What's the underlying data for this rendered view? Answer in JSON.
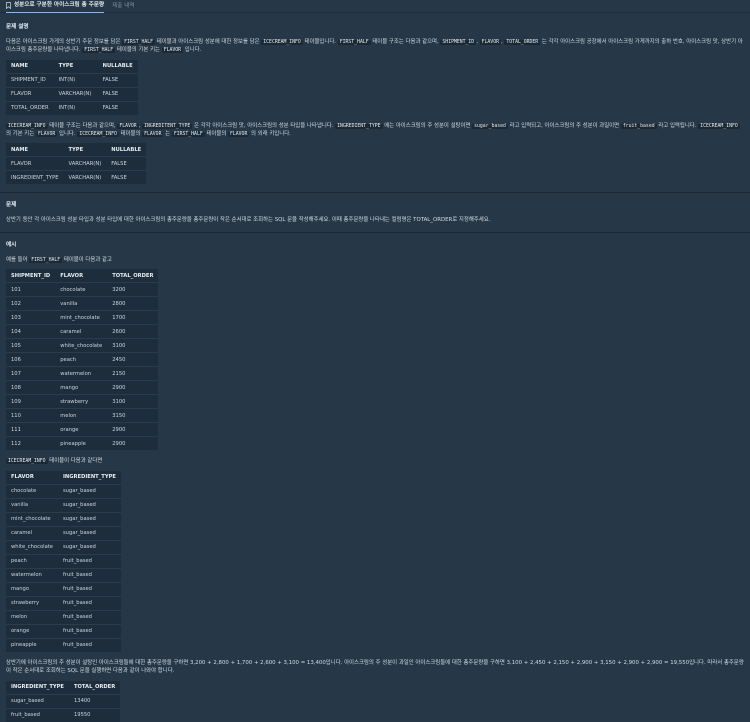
{
  "tabs": {
    "active": "성분으로 구분한 아이스크림 총 주문량",
    "inactive": "제출 내역"
  },
  "section1": {
    "title": "문제 설명",
    "p1": [
      {
        "t": "다음은 아이스크림 가게의 상반기 주문 정보를 담은 "
      },
      {
        "c": "FIRST_HALF"
      },
      {
        "t": " 테이블과 아이스크림 성분에 대한 정보를 담은 "
      },
      {
        "c": "ICECREAM_INFO"
      },
      {
        "t": " 테이블입니다. "
      },
      {
        "c": "FIRST_HALF"
      },
      {
        "t": " 테이블 구조는 다음과 같으며, "
      },
      {
        "c": "SHIPMENT_ID"
      },
      {
        "t": ", "
      },
      {
        "c": "FLAVOR"
      },
      {
        "t": ", "
      },
      {
        "c": "TOTAL_ORDER"
      },
      {
        "t": " 는 각각 아이스크림 공장에서 아이스크림 가게까지의 출하 번호, 아이스크림 맛, 상반기 아이스크림 총주문량을 나타냅니다. "
      },
      {
        "c": "FIRST_HALF"
      },
      {
        "t": " 테이블의 기본 키는 "
      },
      {
        "c": "FLAVOR"
      },
      {
        "t": " 입니다."
      }
    ],
    "table1": {
      "headers": [
        "NAME",
        "TYPE",
        "NULLABLE"
      ],
      "rows": [
        [
          "SHIPMENT_ID",
          "INT(N)",
          "FALSE"
        ],
        [
          "FLAVOR",
          "VARCHAR(N)",
          "FALSE"
        ],
        [
          "TOTAL_ORDER",
          "INT(N)",
          "FALSE"
        ]
      ]
    },
    "p2": [
      {
        "c": "ICECREAM_INFO"
      },
      {
        "t": " 테이블 구조는 다음과 같으며, "
      },
      {
        "c": "FLAVOR"
      },
      {
        "t": ", "
      },
      {
        "c": "INGREDITENT_TYPE"
      },
      {
        "t": " 은 각각 아이스크림 맛, 아이스크림의 성분 타입을 나타냅니다. "
      },
      {
        "c": "INGREDIENT_TYPE"
      },
      {
        "t": " 에는 아이스크림의 주 성분이 설탕이면 "
      },
      {
        "c": "sugar_based"
      },
      {
        "t": " 라고 입력되고, 아이스크림의 주 성분이 과일이면 "
      },
      {
        "c": "fruit_based"
      },
      {
        "t": " 라고 입력됩니다. "
      },
      {
        "c": "ICECREAM_INFO"
      },
      {
        "t": " 의 기본 키는 "
      },
      {
        "c": "FLAVOR"
      },
      {
        "t": " 입니다. "
      },
      {
        "c": "ICECREAM_INFO"
      },
      {
        "t": " 테이블의 "
      },
      {
        "c": "FLAVOR"
      },
      {
        "t": " 는 "
      },
      {
        "c": "FIRST_HALF"
      },
      {
        "t": " 테이블의 "
      },
      {
        "c": "FLAVOR"
      },
      {
        "t": " 의 외래 키입니다."
      }
    ],
    "table2": {
      "headers": [
        "NAME",
        "TYPE",
        "NULLABLE"
      ],
      "rows": [
        [
          "FLAVOR",
          "VARCHAR(N)",
          "FALSE"
        ],
        [
          "INGREDIENT_TYPE",
          "VARCHAR(N)",
          "FALSE"
        ]
      ]
    }
  },
  "section2": {
    "title": "문제",
    "text": "상반기 동안 각 아이스크림 성분 타입과 성분 타입에 대한 아이스크림의 총주문량을 총주문량이 작은 순서대로 조회하는 SQL 문을 작성해주세요. 이때 총주문량을 나타내는 컬럼명은 TOTAL_ORDER로 지정해주세요."
  },
  "section3": {
    "title": "예시",
    "intro": [
      {
        "t": "예를 들어 "
      },
      {
        "c": "FIRST_HALF"
      },
      {
        "t": " 테이블이 다음과 같고"
      }
    ],
    "table3": {
      "headers": [
        "SHIPMENT_ID",
        "FLAVOR",
        "TOTAL_ORDER"
      ],
      "rows": [
        [
          "101",
          "chocolate",
          "3200"
        ],
        [
          "102",
          "vanilla",
          "2800"
        ],
        [
          "103",
          "mint_chocolate",
          "1700"
        ],
        [
          "104",
          "caramel",
          "2600"
        ],
        [
          "105",
          "white_chocolate",
          "3100"
        ],
        [
          "106",
          "peach",
          "2450"
        ],
        [
          "107",
          "watermelon",
          "2150"
        ],
        [
          "108",
          "mango",
          "2900"
        ],
        [
          "109",
          "strawberry",
          "3100"
        ],
        [
          "110",
          "melon",
          "3150"
        ],
        [
          "111",
          "orange",
          "2900"
        ],
        [
          "112",
          "pineapple",
          "2900"
        ]
      ]
    },
    "intro2": [
      {
        "c": "ICECREAM_INFO"
      },
      {
        "t": " 테이블이 다음과 같다면"
      }
    ],
    "table4": {
      "headers": [
        "FLAVOR",
        "INGREDIENT_TYPE"
      ],
      "rows": [
        [
          "chocolate",
          "sugar_based"
        ],
        [
          "vanilla",
          "sugar_based"
        ],
        [
          "mint_chocolate",
          "sugar_based"
        ],
        [
          "caramel",
          "sugar_based"
        ],
        [
          "white_chocolate",
          "sugar_based"
        ],
        [
          "peach",
          "fruit_based"
        ],
        [
          "watermelon",
          "fruit_based"
        ],
        [
          "mango",
          "fruit_based"
        ],
        [
          "strawberry",
          "fruit_based"
        ],
        [
          "melon",
          "fruit_based"
        ],
        [
          "orange",
          "fruit_based"
        ],
        [
          "pineapple",
          "fruit_based"
        ]
      ]
    },
    "explain": "상반기에 아이스크림의 주 성분이 설탕인 아이스크림들에 대한 총주문량을 구하면 3,200 + 2,800 + 1,700 + 2,600 + 3,100 = 13,400입니다. 아이스크림의 주 성분이 과일인 아이스크림들에 대한 총주문량을 구하면 3,100 + 2,450 + 2,150 + 2,900 + 3,150 + 2,900 + 2,900 = 19,550입니다. 따라서 총주문량이 작은 순서대로 조회하는 SQL 문을 실행하면 다음과 같이 나와야 합니다.",
    "table5": {
      "headers": [
        "INGREDIENT_TYPE",
        "TOTAL_ORDER"
      ],
      "rows": [
        [
          "sugar_based",
          "13400"
        ],
        [
          "fruit_based",
          "19550"
        ]
      ]
    }
  },
  "colors": {
    "background": "#263747",
    "accent": "#8ab4f8",
    "table_bg": "#1e2d3c"
  }
}
